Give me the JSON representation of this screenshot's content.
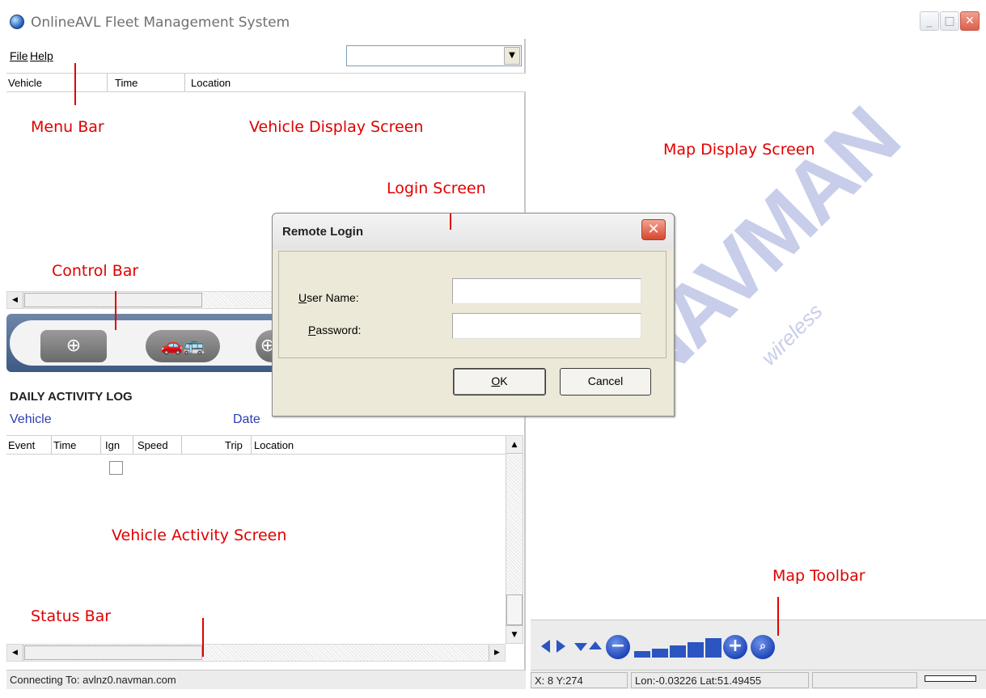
{
  "window": {
    "title": "OnlineAVL Fleet Management System",
    "minimize": "_",
    "maximize": "□",
    "close": "✕"
  },
  "menu": {
    "file": "File",
    "help": "Help"
  },
  "combo": {
    "value": "",
    "arrow": "▼"
  },
  "vehicle_list": {
    "columns": [
      "Vehicle",
      "Time",
      "Location"
    ]
  },
  "control_bar": {
    "buttons": [
      "target-icon",
      "vehicles-icon",
      "target-icon"
    ]
  },
  "activity_log": {
    "title": "DAILY ACTIVITY LOG",
    "vehicle_label": "Vehicle",
    "date_label": "Date",
    "columns": [
      "Event",
      "Time",
      "Ign",
      "Speed",
      "Trip",
      "Location"
    ]
  },
  "status": {
    "connecting": "Connecting To: avlnz0.navman.com",
    "xy": "X:  8 Y:274",
    "lonlat": "Lon:-0.03226 Lat:51.49455"
  },
  "map": {
    "watermark": "NAVMAN",
    "watermark_sub": "wireless",
    "toolbar": [
      "pan-left-icon",
      "pan-right-icon",
      "pan-down-icon",
      "pan-up-icon",
      "zoom-out-icon",
      "zoom-level-1",
      "zoom-level-2",
      "zoom-level-3",
      "zoom-level-4",
      "zoom-level-5",
      "zoom-in-icon",
      "find-icon"
    ]
  },
  "dialog": {
    "title": "Remote Login",
    "username_label_accel": "U",
    "username_label_rest": "ser Name:",
    "password_label_accel": "P",
    "password_label_rest": "assword:",
    "username_value": "",
    "password_value": "",
    "ok_accel": "O",
    "ok_rest": "K",
    "cancel": "Cancel"
  },
  "annotations": {
    "menu_bar": "Menu Bar",
    "vehicle_display": "Vehicle Display Screen",
    "map_display": "Map Display Screen",
    "login_screen": "Login Screen",
    "control_bar": "Control Bar",
    "vehicle_activity": "Vehicle Activity Screen",
    "status_bar": "Status Bar",
    "map_toolbar": "Map Toolbar"
  },
  "colors": {
    "annotation": "#e00000",
    "label_blue": "#2b3db0",
    "map_tool_blue": "#2b55c0",
    "control_bar": "#4f6a92"
  }
}
